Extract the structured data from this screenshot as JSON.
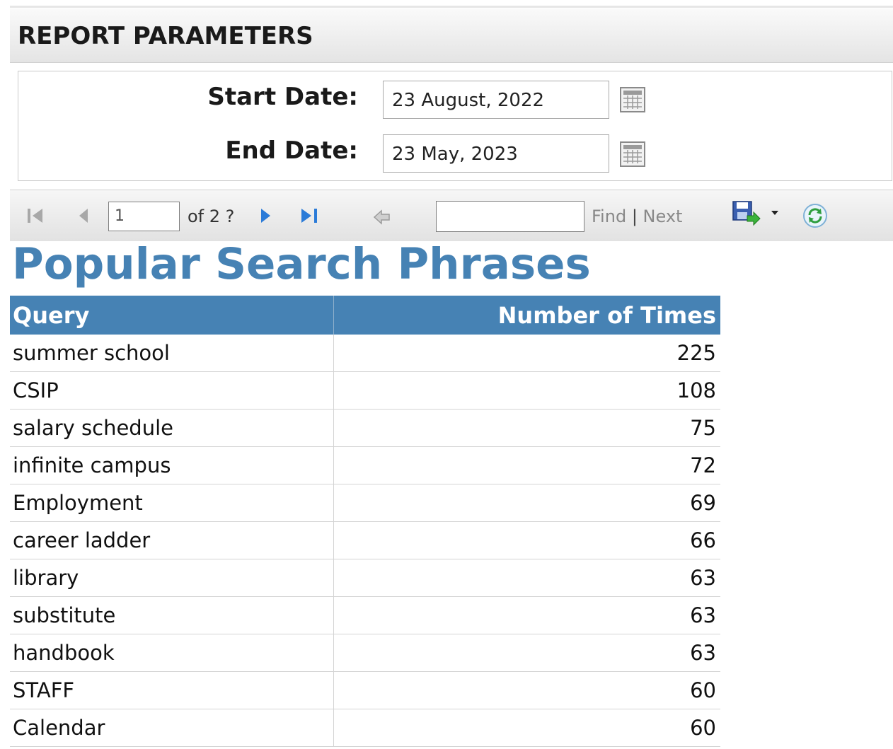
{
  "parameters": {
    "header_title": "REPORT PARAMETERS",
    "start_date": {
      "label": "Start Date:",
      "value": "23 August, 2022"
    },
    "end_date": {
      "label": "End Date:",
      "value": "23 May, 2023"
    }
  },
  "toolbar": {
    "current_page": "1",
    "of_pages_text": "of 2 ?",
    "find_value": "",
    "find_label": "Find",
    "separator": "|",
    "next_label": "Next",
    "icons": [
      "first-page-icon",
      "previous-page-icon",
      "next-page-icon",
      "last-page-icon",
      "back-icon",
      "export-save-icon",
      "dropdown-arrow-icon",
      "refresh-icon"
    ]
  },
  "report": {
    "title": "Popular Search Phrases",
    "columns": [
      "Query",
      "Number of Times"
    ],
    "rows": [
      [
        "summer school",
        "225"
      ],
      [
        "CSIP",
        "108"
      ],
      [
        "salary schedule",
        "75"
      ],
      [
        "infinite campus",
        "72"
      ],
      [
        "Employment",
        "69"
      ],
      [
        "career ladder",
        "66"
      ],
      [
        "library",
        "63"
      ],
      [
        "substitute",
        "63"
      ],
      [
        "handbook",
        "63"
      ],
      [
        "STAFF",
        "60"
      ],
      [
        "Calendar",
        "60"
      ]
    ]
  },
  "colors": {
    "accent": "#4682b4",
    "header_text": "#ffffff"
  }
}
